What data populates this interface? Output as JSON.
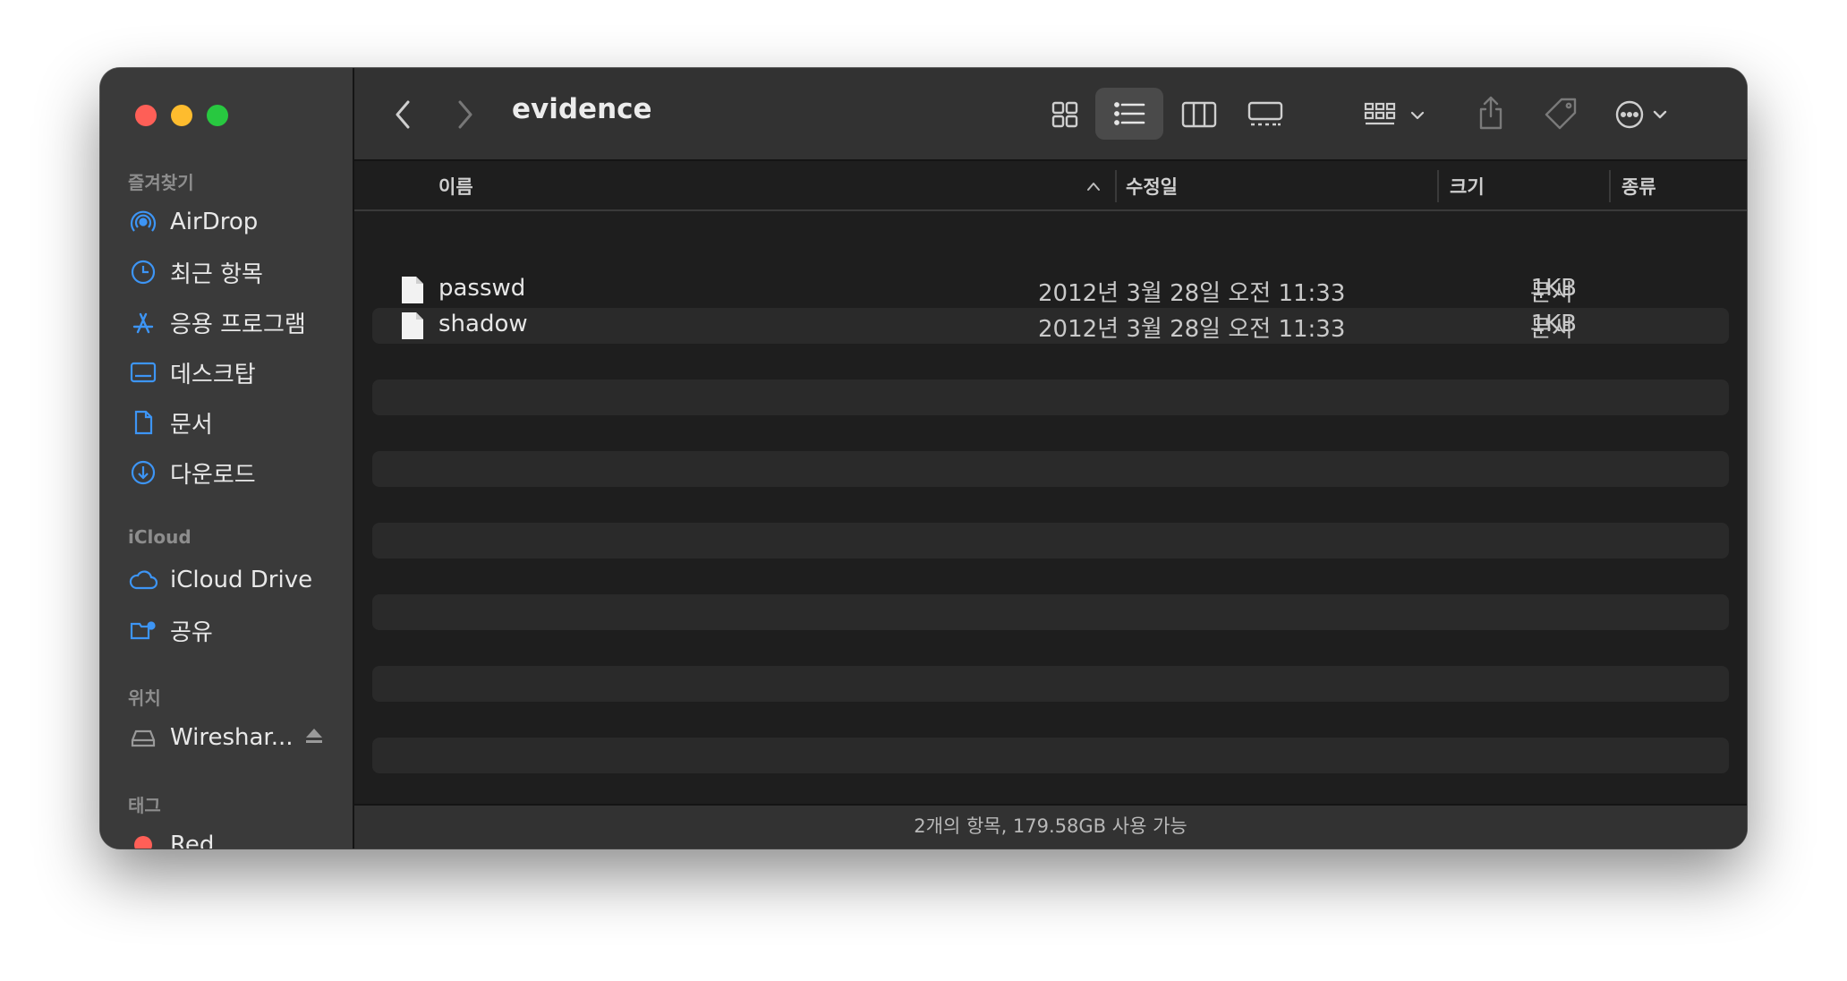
{
  "window": {
    "title": "evidence",
    "colors": {
      "close": "#fe5f57",
      "minimize": "#febc2e",
      "zoom": "#28c840",
      "accent": "#3d95f5"
    }
  },
  "sidebar": {
    "favorites_header": "즐겨찾기",
    "favorites": [
      {
        "label": "AirDrop",
        "icon": "airdrop-icon"
      },
      {
        "label": "최근 항목",
        "icon": "clock-icon"
      },
      {
        "label": "응용 프로그램",
        "icon": "applications-icon"
      },
      {
        "label": "데스크탑",
        "icon": "desktop-icon"
      },
      {
        "label": "문서",
        "icon": "document-icon"
      },
      {
        "label": "다운로드",
        "icon": "download-icon"
      }
    ],
    "icloud_header": "iCloud",
    "icloud": [
      {
        "label": "iCloud Drive",
        "icon": "cloud-icon"
      },
      {
        "label": "공유",
        "icon": "shared-folder-icon"
      }
    ],
    "locations_header": "위치",
    "locations": [
      {
        "label": "Wireshar...",
        "icon": "drive-icon"
      }
    ],
    "tags_header": "태그",
    "tags": [
      {
        "label": "Red",
        "color": "#ff5f57"
      }
    ]
  },
  "toolbar": {
    "icons": [
      "back-icon",
      "forward-icon",
      "icon-view-icon",
      "list-view-icon",
      "column-view-icon",
      "gallery-view-icon",
      "group-icon",
      "share-icon",
      "tag-icon",
      "more-icon",
      "search-icon"
    ],
    "active_view": "list"
  },
  "columns": {
    "name": "이름",
    "modified": "수정일",
    "size": "크기",
    "kind": "종류"
  },
  "files": [
    {
      "name": "passwd",
      "modified": "2012년 3월 28일 오전 11:33",
      "size": "1KB",
      "kind": "문서"
    },
    {
      "name": "shadow",
      "modified": "2012년 3월 28일 오전 11:33",
      "size": "1KB",
      "kind": "문서"
    }
  ],
  "status": "2개의 항목, 179.58GB 사용 가능"
}
